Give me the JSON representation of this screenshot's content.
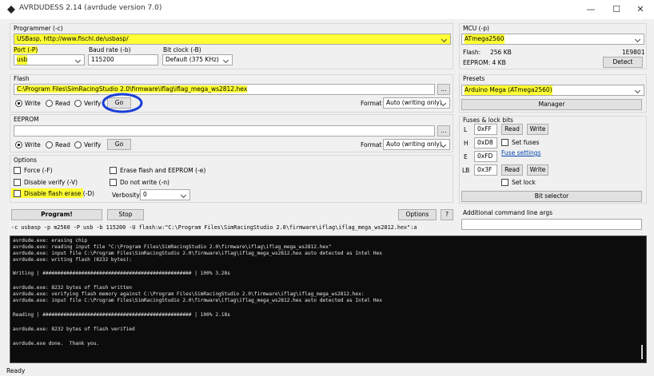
{
  "window": {
    "title": "AVRDUDESS 2.14 (avrdude version 7.0)",
    "min": "—",
    "max": "☐",
    "close": "✕"
  },
  "programmer": {
    "label": "Programmer (-c)",
    "value": "USBasp, http://www.fischl.de/usbasp/"
  },
  "port": {
    "label": "Port (-P)",
    "value": "usb"
  },
  "baud": {
    "label": "Baud rate (-b)",
    "value": "115200"
  },
  "bitclock": {
    "label": "Bit clock (-B)",
    "value": "Default (375 KHz)"
  },
  "mcu": {
    "label": "MCU (-p)",
    "value": "ATmega2560",
    "flash_label": "Flash:",
    "flash_size": "256 KB",
    "signature": "1E9801",
    "eeprom_label": "EEPROM: 4 KB",
    "detect": "Detect"
  },
  "flash": {
    "label": "Flash",
    "file": "C:\\Program Files\\SimRacingStudio 2.0\\firmware\\iflag\\iflag_mega_ws2812.hex",
    "browse": "...",
    "write": "Write",
    "read": "Read",
    "verify": "Verify",
    "go": "Go",
    "format_label": "Format",
    "format": "Auto (writing only)"
  },
  "eeprom": {
    "label": "EEPROM",
    "file": "",
    "browse": "...",
    "write": "Write",
    "read": "Read",
    "verify": "Verify",
    "go": "Go",
    "format_label": "Format",
    "format": "Auto (writing only)"
  },
  "presets": {
    "label": "Presets",
    "value": "Arduino Mega (ATmega2560)",
    "manager": "Manager"
  },
  "fuses": {
    "label": "Fuses & lock bits",
    "rows": [
      {
        "name": "L",
        "value": "0xFF",
        "read": "Read",
        "write": "Write"
      },
      {
        "name": "H",
        "value": "0xD8"
      },
      {
        "name": "E",
        "value": "0xFD"
      },
      {
        "name": "LB",
        "value": "0x3F",
        "read": "Read",
        "write": "Write"
      }
    ],
    "set_fuses": "Set fuses",
    "fuse_settings": "Fuse settings",
    "set_lock": "Set lock",
    "bit_selector": "Bit selector"
  },
  "options": {
    "label": "Options",
    "force": "Force (-F)",
    "disable_verify": "Disable verify (-V)",
    "disable_flash_erase": "Disable flash erase (-D)",
    "erase": "Erase flash and EEPROM (-e)",
    "do_not_write": "Do not write (-n)",
    "verbosity_label": "Verbosity",
    "verbosity": "0"
  },
  "actions": {
    "program": "Program!",
    "stop": "Stop",
    "options": "Options",
    "help": "?"
  },
  "additional": {
    "label": "Additional command line args",
    "value": ""
  },
  "cmdline": "-c usbasp -p m2560 -P usb -b 115200 -U flash:w:\"C:\\Program Files\\SimRacingStudio 2.0\\firmware\\iflag\\iflag_mega_ws2812.hex\":a",
  "console": [
    "avrdude.exe: erasing chip",
    "avrdude.exe: reading input file \"C:\\Program Files\\SimRacingStudio 2.0\\firmware\\iflag\\iflag_mega_ws2812.hex\"",
    "avrdude.exe: input file C:\\Program Files\\SimRacingStudio 2.0\\firmware\\iflag\\iflag_mega_ws2812.hex auto detected as Intel Hex",
    "avrdude.exe: writing flash (8232 bytes):",
    "",
    "Writing | ################################################## | 100% 3.28s",
    "",
    "avrdude.exe: 8232 bytes of flash written",
    "avrdude.exe: verifying flash memory against C:\\Program Files\\SimRacingStudio 2.0\\firmware\\iflag\\iflag_mega_ws2812.hex:",
    "avrdude.exe: input file C:\\Program Files\\SimRacingStudio 2.0\\firmware\\iflag\\iflag_mega_ws2812.hex auto detected as Intel Hex",
    "",
    "Reading | ################################################## | 100% 2.18s",
    "",
    "avrdude.exe: 8232 bytes of flash verified",
    "",
    "avrdude.exe done.  Thank you."
  ],
  "status": "Ready",
  "colors": {
    "highlight": "#ffff33",
    "annotation": "#1a3fd6",
    "link": "#0645ad"
  }
}
